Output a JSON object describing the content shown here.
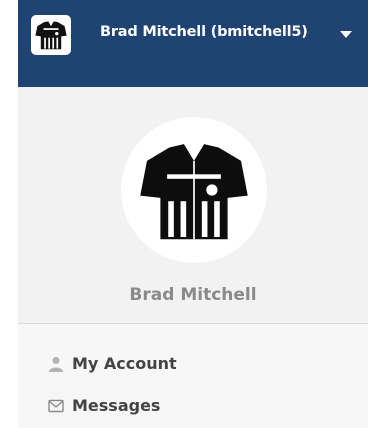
{
  "header": {
    "user_display": "Brad Mitchell (bmitchell5)",
    "avatar_icon": "referee-jersey-icon",
    "dropdown_icon": "caret-down-icon"
  },
  "profile": {
    "avatar_icon": "referee-jersey-icon",
    "name": "Brad Mitchell"
  },
  "menu": {
    "items": [
      {
        "label": "My Account",
        "icon": "user-icon"
      },
      {
        "label": "Messages",
        "icon": "envelope-icon"
      }
    ]
  },
  "colors": {
    "header_bg": "#1f4373",
    "panel_bg": "#f2f2f2",
    "name_text": "#8a8a8a",
    "menu_text": "#444444"
  }
}
